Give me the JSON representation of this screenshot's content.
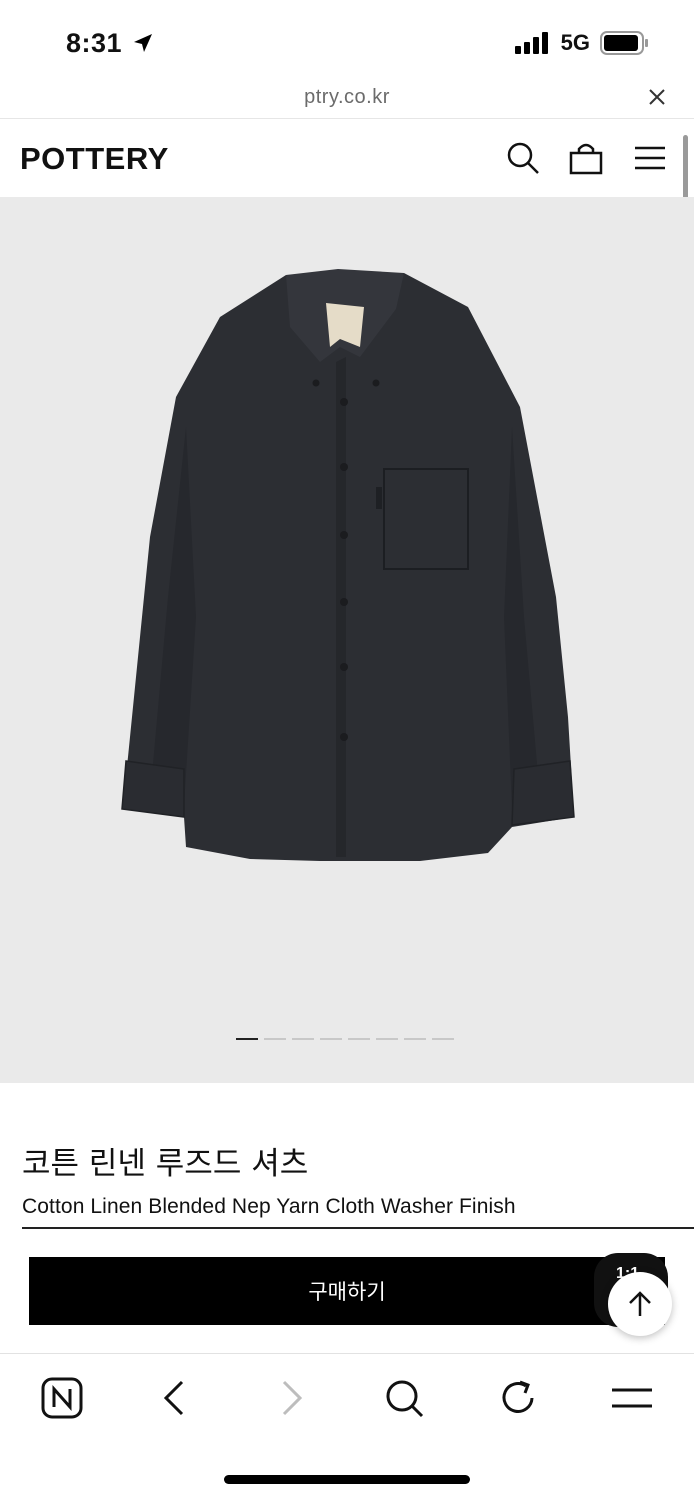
{
  "status_bar": {
    "time": "8:31",
    "network": "5G"
  },
  "url_bar": {
    "url": "ptry.co.kr"
  },
  "site": {
    "logo": "POTTERY"
  },
  "gallery": {
    "slide_count": 8,
    "active_slide": 1
  },
  "product": {
    "title_ko": "코튼 린넨 루즈드 셔츠",
    "title_en": "Cotton Linen Blended Nep Yarn Cloth Washer Finish",
    "buy_label": "구매하기",
    "chip_label": "1:1"
  },
  "icons": {
    "search": "search-icon",
    "bag": "shopping-bag-icon",
    "menu": "hamburger-menu-icon",
    "close": "close-icon",
    "up": "arrow-up-icon"
  },
  "colors": {
    "gallery_bg": "#eaeaea",
    "shirt": "#2c2e33",
    "button": "#000000"
  }
}
